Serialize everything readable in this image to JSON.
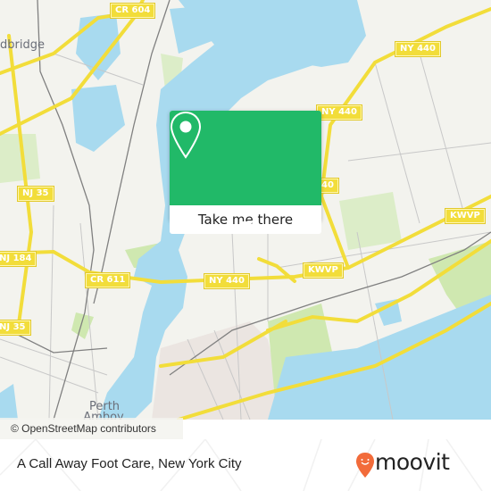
{
  "map": {
    "place_labels": [
      {
        "id": "woodbridge",
        "text": "dbridge"
      },
      {
        "id": "perth-amboy-1",
        "text": "Perth"
      },
      {
        "id": "perth-amboy-2",
        "text": "Amboy"
      }
    ],
    "road_shields": [
      {
        "id": "cr-604",
        "text": "CR 604"
      },
      {
        "id": "ny-440-north",
        "text": "NY 440"
      },
      {
        "id": "ny-440-mid",
        "text": "NY 440"
      },
      {
        "id": "ny-440-partial",
        "text": "40"
      },
      {
        "id": "nj-35-north",
        "text": "NJ 35"
      },
      {
        "id": "nj-184",
        "text": "NJ 184"
      },
      {
        "id": "cr-611",
        "text": "CR 611"
      },
      {
        "id": "ny-440-bridge",
        "text": "NY 440"
      },
      {
        "id": "kwvp-interchange",
        "text": "KWVP"
      },
      {
        "id": "kwvp-east",
        "text": "KWVP"
      },
      {
        "id": "nj-35-south",
        "text": "NJ 35"
      }
    ],
    "colors": {
      "land": "#f3f3ee",
      "water": "#a8daef",
      "park": "#cfe8b0",
      "urban": "#ebe5e1",
      "highway": "#f2dd3a",
      "road": "#c8c8c8",
      "rail": "#808080"
    },
    "attribution": "© OpenStreetMap contributors"
  },
  "popup": {
    "icon": "map-pin-icon",
    "button_label": "Take me there",
    "color": "#21b968"
  },
  "footer": {
    "title": "A Call Away Foot Care, New York City",
    "logo_text": "moovit",
    "logo_color": "#f26b3a"
  }
}
